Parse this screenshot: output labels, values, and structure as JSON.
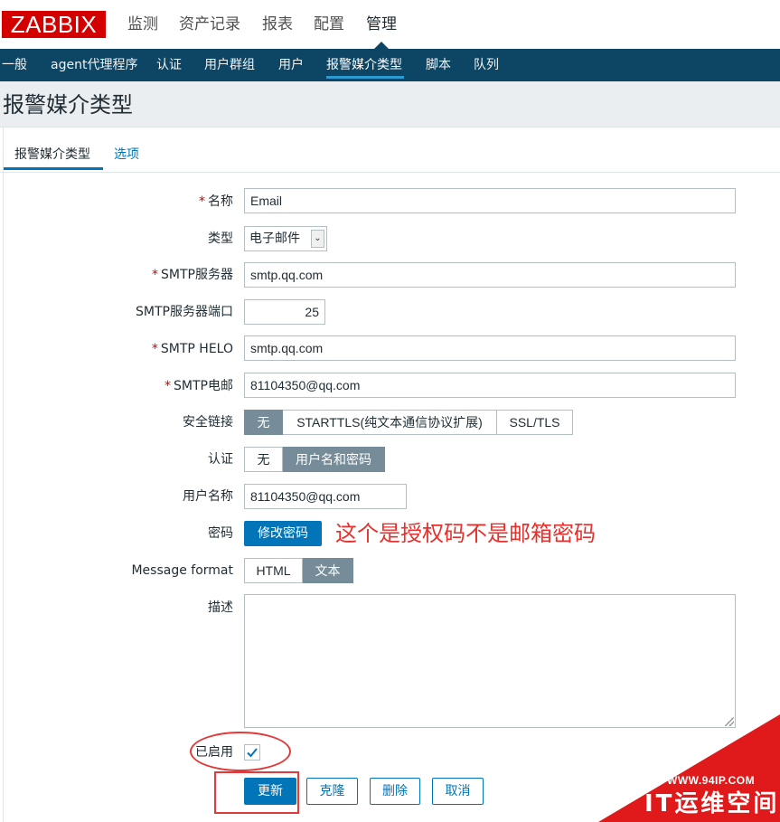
{
  "brand": {
    "logo": "ZABBIX",
    "color": "#d40000"
  },
  "menu": [
    {
      "label": "监测"
    },
    {
      "label": "资产记录"
    },
    {
      "label": "报表"
    },
    {
      "label": "配置"
    },
    {
      "label": "管理",
      "active": true
    }
  ],
  "submenu": [
    {
      "label": "一般"
    },
    {
      "label": "agent代理程序"
    },
    {
      "label": "认证"
    },
    {
      "label": "用户群组"
    },
    {
      "label": "用户"
    },
    {
      "label": "报警媒介类型",
      "active": true
    },
    {
      "label": "脚本"
    },
    {
      "label": "队列"
    }
  ],
  "page": {
    "title": "报警媒介类型"
  },
  "tabs": [
    {
      "label": "报警媒介类型",
      "active": true
    },
    {
      "label": "选项"
    }
  ],
  "form": {
    "name": {
      "label": "名称",
      "required": "*",
      "value": "Email"
    },
    "type": {
      "label": "类型",
      "value": "电子邮件"
    },
    "smtp_server": {
      "label": "SMTP服务器",
      "required": "*",
      "value": "smtp.qq.com"
    },
    "smtp_port": {
      "label": "SMTP服务器端口",
      "value": "25"
    },
    "smtp_helo": {
      "label": "SMTP HELO",
      "required": "*",
      "value": "smtp.qq.com"
    },
    "smtp_email": {
      "label": "SMTP电邮",
      "required": "*",
      "value": "81104350@qq.com"
    },
    "security": {
      "label": "安全链接",
      "options": [
        "无",
        "STARTTLS(纯文本通信协议扩展)",
        "SSL/TLS"
      ],
      "selected": "无"
    },
    "auth": {
      "label": "认证",
      "options": [
        "无",
        "用户名和密码"
      ],
      "selected": "用户名和密码"
    },
    "username": {
      "label": "用户名称",
      "value": "81104350@qq.com"
    },
    "password": {
      "label": "密码",
      "button": "修改密码"
    },
    "message_format": {
      "label": "Message format",
      "options": [
        "HTML",
        "文本"
      ],
      "selected": "文本"
    },
    "description": {
      "label": "描述",
      "value": ""
    },
    "enabled": {
      "label": "已启用",
      "checked": true
    }
  },
  "annotation": {
    "note": "这个是授权码不是邮箱密码",
    "color": "#e8302c"
  },
  "buttons": {
    "update": "更新",
    "clone": "克隆",
    "delete": "删除",
    "cancel": "取消"
  },
  "watermark": {
    "url": "WWW.94IP.COM",
    "text": "IT运维空间",
    "color": "#e01a1a"
  },
  "colors": {
    "nav_bg": "#0d4665",
    "primary": "#0275b8",
    "segment_on": "#768d99"
  }
}
